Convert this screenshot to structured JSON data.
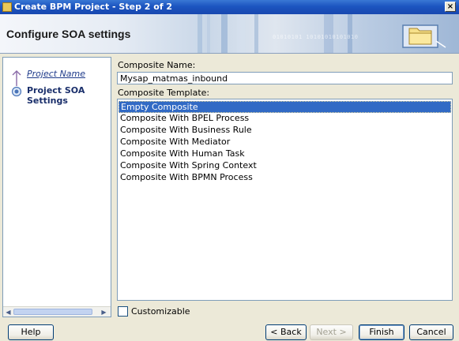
{
  "window": {
    "title": "Create BPM Project - Step 2 of 2",
    "close_glyph": "×"
  },
  "header": {
    "title": "Configure SOA settings",
    "binary_text": "01010101 10101010101010"
  },
  "steps": [
    {
      "label": "Project Name",
      "state": "visited"
    },
    {
      "label": "Project SOA Settings",
      "state": "current"
    }
  ],
  "form": {
    "composite_name_label": "Composite Name:",
    "composite_name_value": "Mysap_matmas_inbound",
    "composite_template_label": "Composite Template:",
    "templates": [
      {
        "label": "Empty Composite",
        "selected": true
      },
      {
        "label": "Composite With BPEL Process",
        "selected": false
      },
      {
        "label": "Composite With Business Rule",
        "selected": false
      },
      {
        "label": "Composite With Mediator",
        "selected": false
      },
      {
        "label": "Composite With Human Task",
        "selected": false
      },
      {
        "label": "Composite With Spring Context",
        "selected": false
      },
      {
        "label": "Composite With BPMN Process",
        "selected": false
      }
    ],
    "customizable_label": "Customizable",
    "customizable_checked": false
  },
  "buttons": {
    "help": "Help",
    "back": "< Back",
    "next": "Next >",
    "finish": "Finish",
    "cancel": "Cancel"
  },
  "colors": {
    "title_bar": "#1c55c0",
    "selection": "#316ac5",
    "current_step": "#1a2f6b"
  }
}
